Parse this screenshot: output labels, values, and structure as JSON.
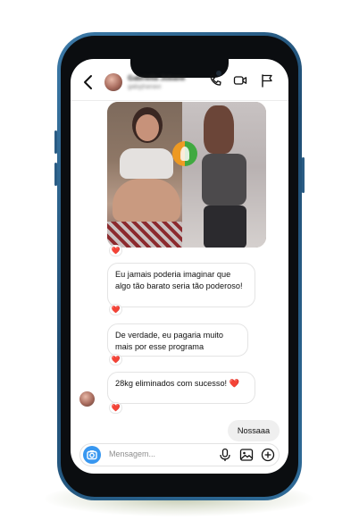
{
  "header": {
    "back_label": "back",
    "contact_name": "Gabriella Jobane",
    "contact_handle": "gabyjhanavi",
    "icons": [
      "back-arrow-icon",
      "phone-icon",
      "video-icon",
      "flag-icon"
    ]
  },
  "chat": {
    "image_reaction": "❤️",
    "messages": [
      {
        "text": "Eu jamais poderia imaginar que algo tão barato seria tão poderoso!",
        "reaction": "❤️"
      },
      {
        "text": "De verdade, eu pagaria muito mais por esse programa",
        "reaction": "❤️"
      },
      {
        "text": "28kg eliminados com sucesso! ❤️",
        "reaction": "❤️"
      }
    ],
    "outgoing": [
      {
        "text": "Nossaaa"
      }
    ]
  },
  "composer": {
    "placeholder": "Mensagem...",
    "icons": [
      "camera-icon",
      "microphone-icon",
      "gallery-icon",
      "add-icon"
    ]
  },
  "colors": {
    "frame": "#2f6b98",
    "accent": "#3897f0",
    "heart": "#e0245e"
  }
}
